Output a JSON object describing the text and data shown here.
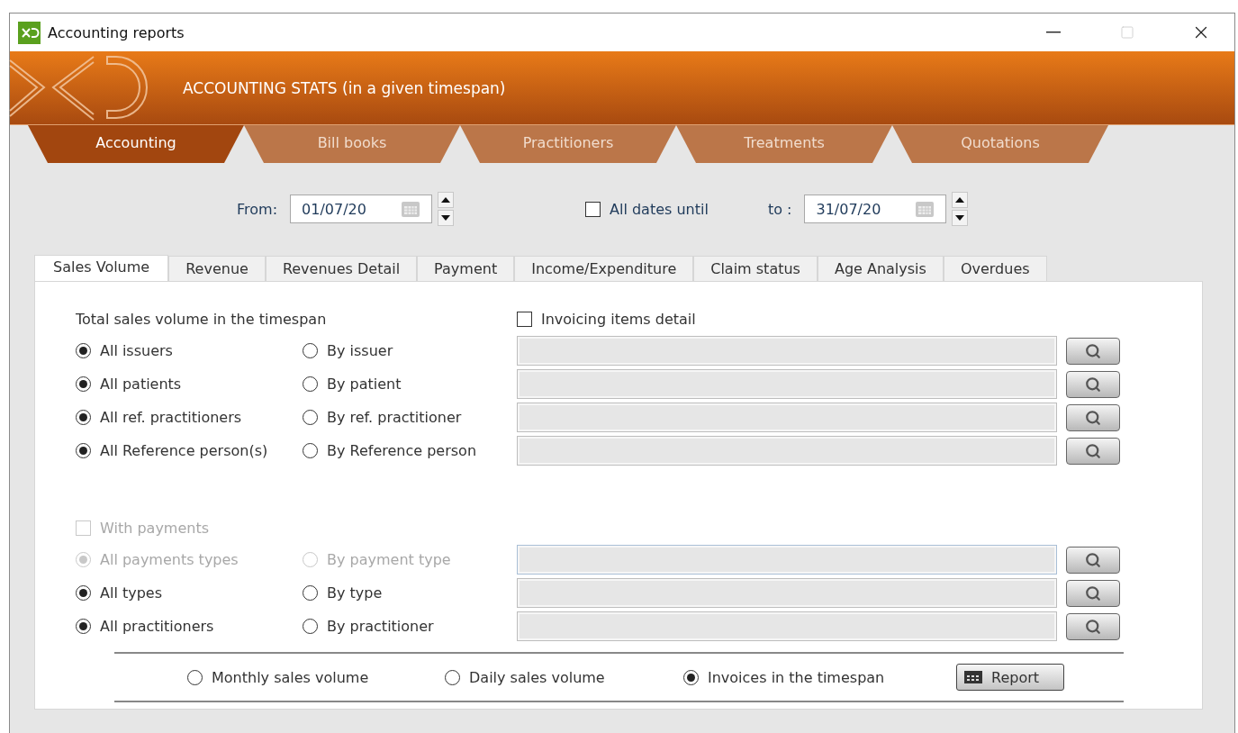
{
  "window": {
    "title": "Accounting reports"
  },
  "header": {
    "title": "ACCOUNTING STATS (in a given timespan)"
  },
  "main_tabs": [
    {
      "label": "Accounting",
      "selected": true
    },
    {
      "label": "Bill books",
      "selected": false
    },
    {
      "label": "Practitioners",
      "selected": false
    },
    {
      "label": "Treatments",
      "selected": false
    },
    {
      "label": "Quotations",
      "selected": false
    }
  ],
  "date_range": {
    "from_label": "From:",
    "from_value": "01/07/20",
    "all_dates": {
      "label": "All dates until",
      "checked": false
    },
    "to_label": "to :",
    "to_value": "31/07/20"
  },
  "sub_tabs": [
    {
      "label": "Sales Volume",
      "selected": true
    },
    {
      "label": "Revenue",
      "selected": false
    },
    {
      "label": "Revenues Detail",
      "selected": false
    },
    {
      "label": "Payment",
      "selected": false
    },
    {
      "label": "Income/Expenditure",
      "selected": false
    },
    {
      "label": "Claim status",
      "selected": false
    },
    {
      "label": "Age Analysis",
      "selected": false
    },
    {
      "label": "Overdues",
      "selected": false
    }
  ],
  "section_title": "Total sales volume in the timespan",
  "invoicing_detail": {
    "label": "Invoicing items detail",
    "checked": false
  },
  "filters_top": [
    {
      "disabled": false,
      "options": [
        {
          "label": "All issuers",
          "selected": true
        },
        {
          "label": "By issuer",
          "selected": false
        }
      ]
    },
    {
      "disabled": false,
      "options": [
        {
          "label": "All patients",
          "selected": true
        },
        {
          "label": "By patient",
          "selected": false
        }
      ]
    },
    {
      "disabled": false,
      "options": [
        {
          "label": "All ref. practitioners",
          "selected": true
        },
        {
          "label": "By ref. practitioner",
          "selected": false
        }
      ]
    },
    {
      "disabled": false,
      "options": [
        {
          "label": "All Reference person(s)",
          "selected": true
        },
        {
          "label": "By Reference person",
          "selected": false
        }
      ]
    }
  ],
  "with_payments": {
    "label": "With payments",
    "checked": false,
    "disabled": true
  },
  "filters_bottom": [
    {
      "disabled": true,
      "options": [
        {
          "label": "All payments types",
          "selected": true
        },
        {
          "label": "By payment type",
          "selected": false
        }
      ]
    },
    {
      "disabled": false,
      "options": [
        {
          "label": "All types",
          "selected": true
        },
        {
          "label": "By type",
          "selected": false
        }
      ]
    },
    {
      "disabled": false,
      "options": [
        {
          "label": "All practitioners",
          "selected": true
        },
        {
          "label": "By practitioner",
          "selected": false
        }
      ]
    }
  ],
  "output_options": [
    {
      "label": "Monthly sales volume",
      "selected": false
    },
    {
      "label": "Daily sales volume",
      "selected": false
    },
    {
      "label": "Invoices in the timespan",
      "selected": true
    }
  ],
  "report_button": "Report"
}
